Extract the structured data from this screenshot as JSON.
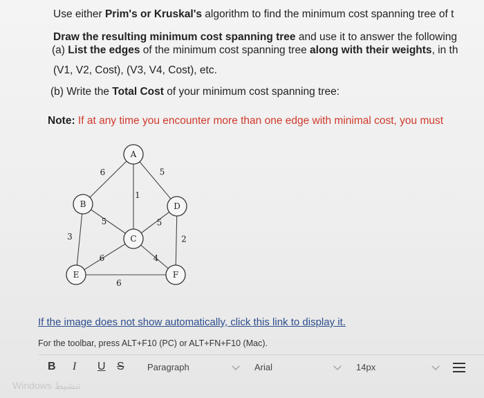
{
  "question": {
    "line1_pre": "Use either ",
    "line1_bold": "Prim's or Kruskal's",
    "line1_post": " algorithm to find the minimum cost spanning tree of t",
    "line2_bold": "Draw the resulting minimum cost spanning tree",
    "line2_post": " and use it to answer the following",
    "line3_pre": "(a) ",
    "line3_bold": "List the edges",
    "line3_mid": " of the minimum cost spanning tree ",
    "line3_bold2": "along with their weights",
    "line3_post": ", in th",
    "line4": "(V1, V2, Cost), (V3, V4, Cost), etc.",
    "line5_pre": "(b) Write the ",
    "line5_bold": "Total Cost",
    "line5_post": " of your minimum cost spanning tree:",
    "note_label": "Note:",
    "note_text": " If at any time you encounter more than one edge with minimal cost, you must"
  },
  "graph": {
    "nodes": [
      {
        "id": "A",
        "label": "A"
      },
      {
        "id": "B",
        "label": "B"
      },
      {
        "id": "C",
        "label": "C"
      },
      {
        "id": "D",
        "label": "D"
      },
      {
        "id": "E",
        "label": "E"
      },
      {
        "id": "F",
        "label": "F"
      }
    ],
    "edges": [
      {
        "from": "A",
        "to": "B",
        "weight": "6"
      },
      {
        "from": "A",
        "to": "D",
        "weight": "5"
      },
      {
        "from": "A",
        "to": "C",
        "weight": "1"
      },
      {
        "from": "B",
        "to": "C",
        "weight": "5"
      },
      {
        "from": "C",
        "to": "D",
        "weight": "5"
      },
      {
        "from": "B",
        "to": "E",
        "weight": "3"
      },
      {
        "from": "D",
        "to": "F",
        "weight": "2"
      },
      {
        "from": "C",
        "to": "E",
        "weight": "6"
      },
      {
        "from": "C",
        "to": "F",
        "weight": "4"
      },
      {
        "from": "E",
        "to": "F",
        "weight": "6"
      }
    ]
  },
  "link_text": "If the image does not show automatically, click this link to display it.",
  "toolbar_hint": "For the toolbar, press ALT+F10 (PC) or ALT+FN+F10 (Mac).",
  "toolbar": {
    "bold": "B",
    "italic": "I",
    "underline": "U",
    "strike": "S",
    "paragraph": "Paragraph",
    "font": "Arial",
    "size": "14px"
  },
  "watermark": "Windows تنشيط"
}
